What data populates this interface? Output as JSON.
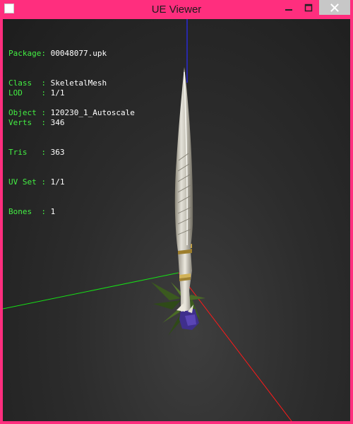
{
  "window": {
    "title": "UE Viewer"
  },
  "info": {
    "lines": [
      {
        "label": "Package: ",
        "value": "00048077.upk"
      },
      {
        "label": "Class  : ",
        "value": "SkeletalMesh"
      },
      {
        "label": "Object : ",
        "value": "120230_1_Autoscale"
      },
      {
        "label": "LOD    : ",
        "value": "1/1"
      },
      {
        "label": "Verts  : ",
        "value": "346"
      },
      {
        "label": "Tris   : ",
        "value": "363"
      },
      {
        "label": "UV Set : ",
        "value": "1/1"
      },
      {
        "label": "Bones  : ",
        "value": "1"
      }
    ]
  },
  "colors": {
    "title_bar": "#ff2e7e",
    "info_label": "#43f043",
    "info_value": "#ffffff",
    "axis_x": "#ff1a1a",
    "axis_y": "#16e016",
    "axis_z": "#2a2aff"
  },
  "icons": {
    "app": "app-icon",
    "minimize": "minimize-icon",
    "maximize": "maximize-icon",
    "close": "close-icon"
  }
}
